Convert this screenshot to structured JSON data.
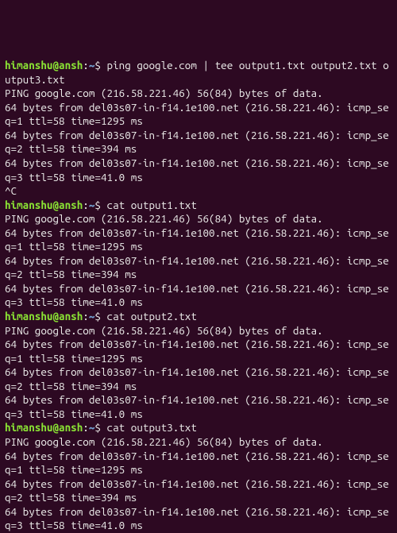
{
  "colors": {
    "background": "#2d0922",
    "prompt_user": "#8ae234",
    "prompt_path": "#729fcf",
    "text": "#eeeeec"
  },
  "prompt": {
    "user": "himanshu@ansh",
    "sep": ":",
    "path": "~",
    "sigil": "$ "
  },
  "commands": {
    "cmd1": "ping google.com | tee output1.txt output2.txt output3.txt",
    "cmd2": "cat output1.txt",
    "cmd3": "cat output2.txt",
    "cmd4": "cat output3.txt"
  },
  "ping_output": {
    "header": "PING google.com (216.58.221.46) 56(84) bytes of data.",
    "line1": "64 bytes from del03s07-in-f14.1e100.net (216.58.221.46): icmp_seq=1 ttl=58 time=1295 ms",
    "line2": "64 bytes from del03s07-in-f14.1e100.net (216.58.221.46): icmp_seq=2 ttl=58 time=394 ms",
    "line3": "64 bytes from del03s07-in-f14.1e100.net (216.58.221.46): icmp_seq=3 ttl=58 time=41.0 ms"
  },
  "interrupt": "^C"
}
